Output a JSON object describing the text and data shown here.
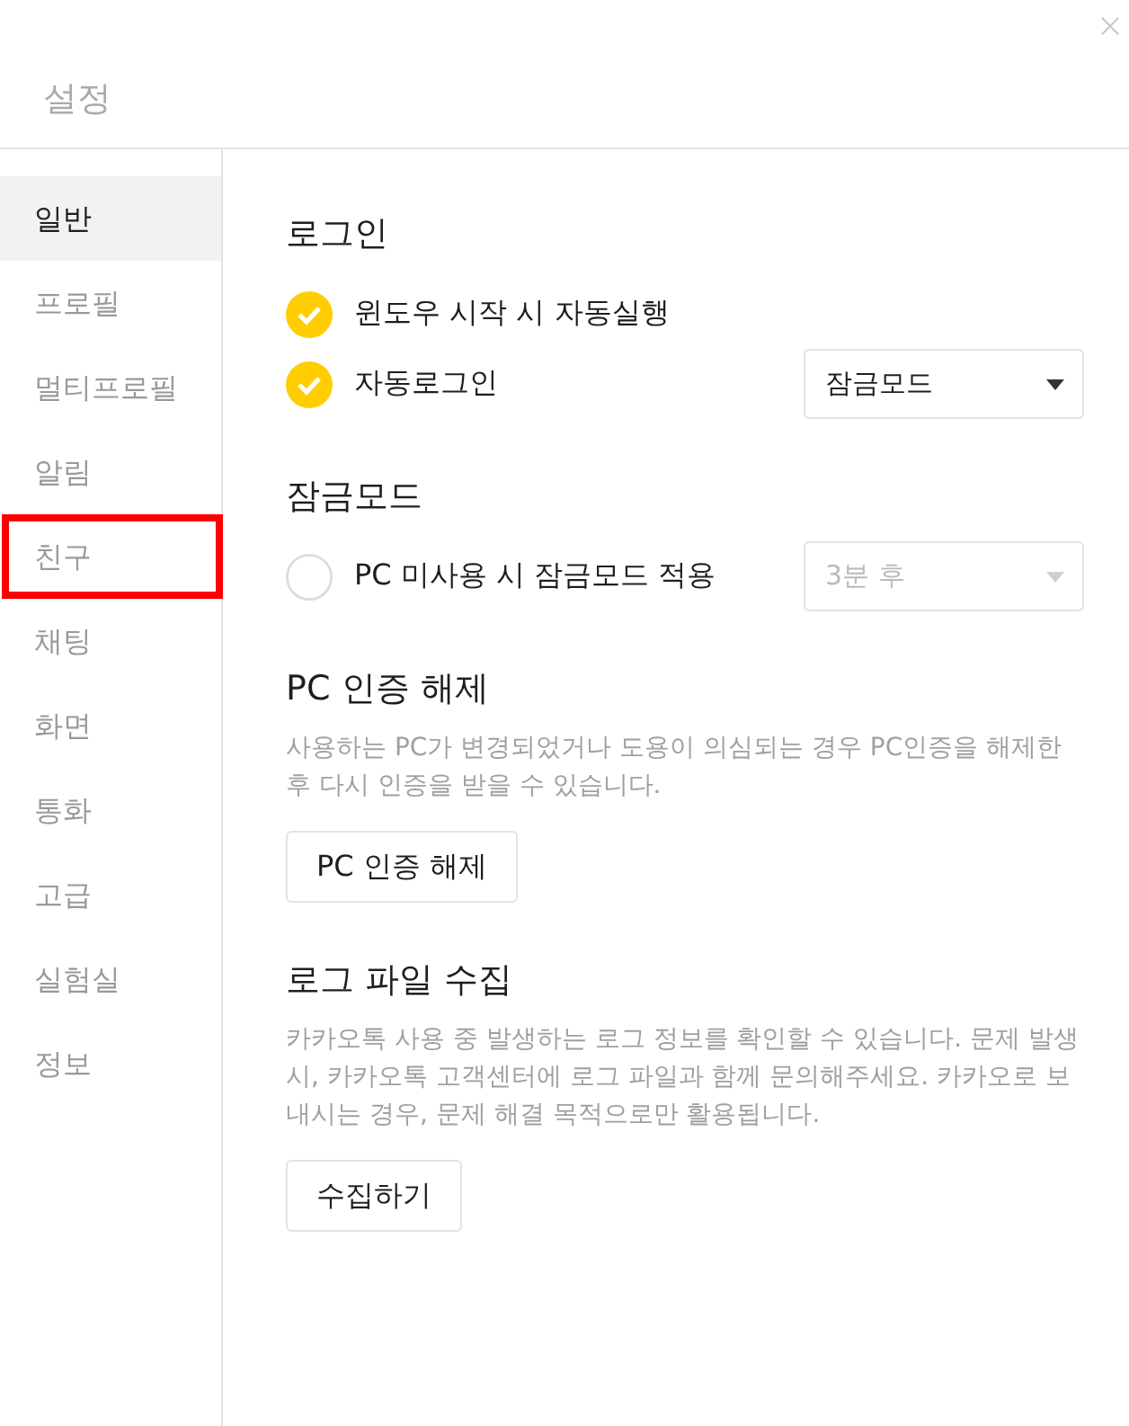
{
  "window": {
    "title": "설정"
  },
  "sidebar": {
    "items": [
      {
        "label": "일반",
        "selected": true,
        "highlighted": false
      },
      {
        "label": "프로필",
        "selected": false,
        "highlighted": false
      },
      {
        "label": "멀티프로필",
        "selected": false,
        "highlighted": false
      },
      {
        "label": "알림",
        "selected": false,
        "highlighted": false
      },
      {
        "label": "친구",
        "selected": false,
        "highlighted": true
      },
      {
        "label": "채팅",
        "selected": false,
        "highlighted": false
      },
      {
        "label": "화면",
        "selected": false,
        "highlighted": false
      },
      {
        "label": "통화",
        "selected": false,
        "highlighted": false
      },
      {
        "label": "고급",
        "selected": false,
        "highlighted": false
      },
      {
        "label": "실험실",
        "selected": false,
        "highlighted": false
      },
      {
        "label": "정보",
        "selected": false,
        "highlighted": false
      }
    ]
  },
  "sections": [
    {
      "title": "로그인",
      "rows": [
        {
          "kind": "checkbox",
          "label": "윈도우 시작 시 자동실행",
          "checked": true
        },
        {
          "kind": "checkbox",
          "label": "자동로그인",
          "checked": true,
          "dropdown": {
            "value": "잠금모드",
            "disabled": false
          }
        }
      ]
    },
    {
      "title": "잠금모드",
      "rows": [
        {
          "kind": "checkbox",
          "label": "PC 미사용 시 잠금모드 적용",
          "checked": false,
          "dropdown": {
            "value": "3분 후",
            "disabled": true
          }
        }
      ]
    },
    {
      "title": "PC 인증 해제",
      "description": "사용하는 PC가 변경되었거나 도용이 의심되는 경우 PC인증을 해제한 후 다시 인증을 받을 수 있습니다.",
      "button": "PC 인증 해제"
    },
    {
      "title": "로그 파일 수집",
      "description": "카카오톡 사용 중 발생하는 로그 정보를 확인할 수 있습니다. 문제 발생시, 카카오톡 고객센터에 로그 파일과 함께 문의해주세요. 카카오로 보내시는 경우, 문제 해결 목적으로만 활용됩니다.",
      "button": "수집하기"
    }
  ]
}
